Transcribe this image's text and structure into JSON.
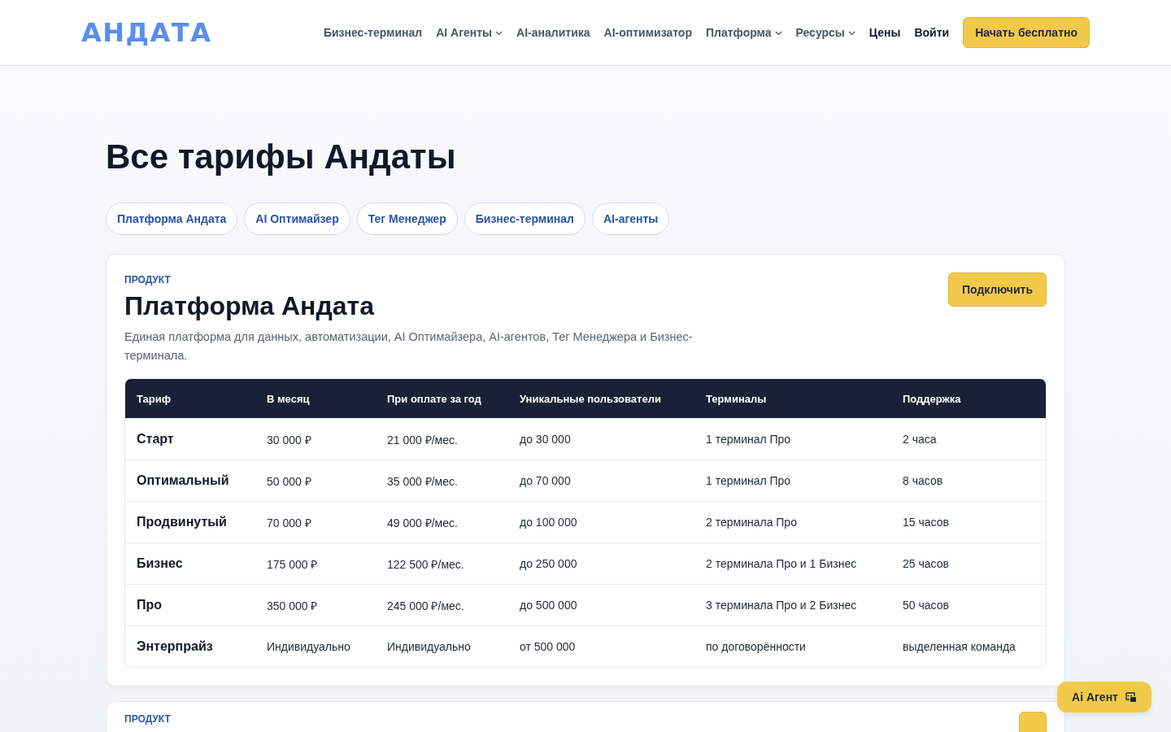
{
  "header": {
    "logo": "АНДАТА",
    "nav": [
      {
        "label": "Бизнес-терминал",
        "kind": "link"
      },
      {
        "label": "AI Агенты",
        "kind": "menu"
      },
      {
        "label": "AI-аналитика",
        "kind": "link"
      },
      {
        "label": "AI-оптимизатор",
        "kind": "link"
      },
      {
        "label": "Платформа",
        "kind": "menu"
      },
      {
        "label": "Ресурсы",
        "kind": "menu"
      },
      {
        "label": "Цены",
        "kind": "action"
      },
      {
        "label": "Войти",
        "kind": "action"
      }
    ],
    "cta": "Начать бесплатно"
  },
  "title": "Все тарифы Андаты",
  "chips": [
    "Платформа Андата",
    "AI Оптимайзер",
    "Тег Менеджер",
    "Бизнес-терминал",
    "AI-агенты"
  ],
  "products": [
    {
      "eyebrow": "ПРОДУКТ",
      "name": "Платформа Андата",
      "description": "Единая платформа для данных, автоматизации, AI Оптимайзера, AI-агентов, Тег Менеджера и Бизнес-терминала.",
      "button": "Подключить",
      "table": {
        "columns": [
          "Тариф",
          "В месяц",
          "При оплате за год",
          "Уникальные пользователи",
          "Терминалы",
          "Поддержка"
        ],
        "rows": [
          [
            "Старт",
            "30 000 ₽",
            "21 000 ₽/мес.",
            "до 30 000",
            "1 терминал Про",
            "2 часа"
          ],
          [
            "Оптимальный",
            "50 000 ₽",
            "35 000 ₽/мес.",
            "до 70 000",
            "1 терминал Про",
            "8 часов"
          ],
          [
            "Продвинутый",
            "70 000 ₽",
            "49 000 ₽/мес.",
            "до 100 000",
            "2 терминала Про",
            "15 часов"
          ],
          [
            "Бизнес",
            "175 000 ₽",
            "122 500 ₽/мес.",
            "до 250 000",
            "2 терминала Про и 1 Бизнес",
            "25 часов"
          ],
          [
            "Про",
            "350 000 ₽",
            "245 000 ₽/мес.",
            "до 500 000",
            "3 терминала Про и 2 Бизнес",
            "50 часов"
          ],
          [
            "Энтерпрайз",
            "Индивидуально",
            "Индивидуально",
            "от 500 000",
            "по договорённости",
            "выделенная команда"
          ]
        ]
      }
    },
    {
      "eyebrow": "ПРОДУКТ"
    }
  ],
  "assistant": {
    "label": "Ai Агент"
  }
}
